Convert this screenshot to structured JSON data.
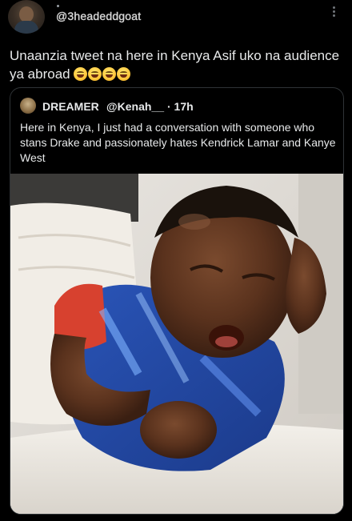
{
  "author": {
    "username": "@3headeddgoat"
  },
  "tweet": {
    "text": "Unaanzia tweet na here in Kenya Asif uko na audience ya abroad",
    "emoji_count": 4,
    "emoji_icon": "grinning-sweat-face-emoji"
  },
  "quoted_tweet": {
    "display_name": "DREAMER",
    "handle": "@Kenah__",
    "time": "· 17h",
    "text": "Here in Kenya, I just had a conversation with someone who stans Drake and passionately hates Kendrick Lamar and Kanye West",
    "image_description_icon": "crying-baby-photo"
  },
  "icons": {
    "more": "more-vertical-icon"
  }
}
